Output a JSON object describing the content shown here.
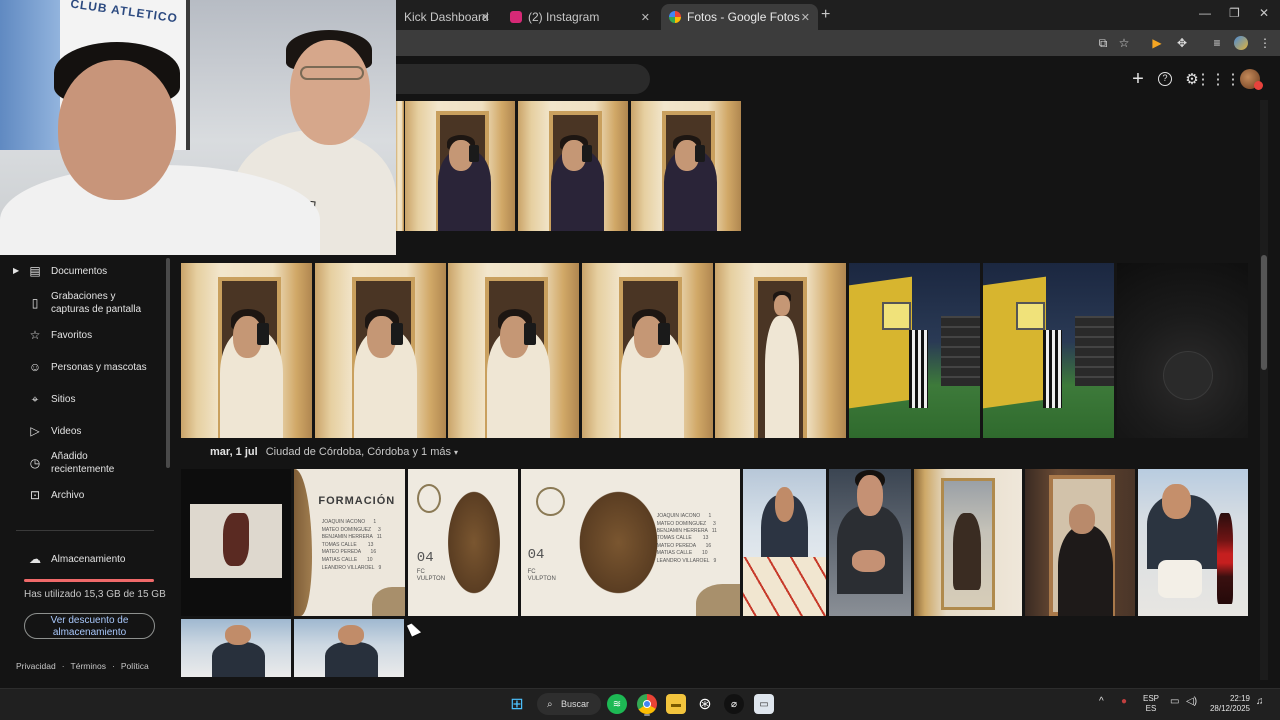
{
  "browser": {
    "tabs": [
      {
        "title": "Kick Dashboard",
        "favicon_color": "#53fc18"
      },
      {
        "title": "(2) Instagram",
        "favicon_color": "#d62976"
      },
      {
        "title": "Fotos - Google Fotos",
        "favicon_color": "#4285f4",
        "active": true
      }
    ],
    "new_tab_icon": "plus-icon",
    "window_controls": [
      "minimize-icon",
      "restore-icon",
      "close-icon"
    ]
  },
  "app_header": {
    "actions": [
      "add-icon",
      "help-icon",
      "settings-icon",
      "apps-grid-icon",
      "account-avatar"
    ]
  },
  "sidebar": {
    "items": [
      {
        "label": "Documentos",
        "icon": "document-icon"
      },
      {
        "label": "Grabaciones y capturas de pantalla",
        "line1": "Grabaciones y",
        "line2": "capturas de pantalla",
        "icon": "phone-screen-icon"
      },
      {
        "label": "Favoritos",
        "icon": "star-icon"
      },
      {
        "label": "Personas y mascotas",
        "icon": "face-icon"
      },
      {
        "label": "Sitios",
        "icon": "location-pin-icon"
      },
      {
        "label": "Videos",
        "icon": "play-icon"
      },
      {
        "label": "Añadido recientemente",
        "line1": "Añadido",
        "line2": "recientemente",
        "icon": "clock-icon"
      },
      {
        "label": "Archivo",
        "icon": "archive-icon"
      }
    ],
    "storage": {
      "label": "Almacenamiento",
      "usage_text": "Has utilizado 15,3 GB de 15 GB",
      "usage_fraction": 1.0,
      "bar_color": "#f06a6a",
      "button_line1": "Ver descuento de",
      "button_line2": "almacenamiento"
    },
    "footer": {
      "privacy": "Privacidad",
      "terms": "Términos",
      "policy": "Política",
      "separator": "·"
    }
  },
  "photo_groups": {
    "date_header": {
      "date": "mar, 1 jul",
      "location": "Ciudad de Córdoba, Córdoba y 1 más"
    },
    "poster": {
      "title": "FORMACIÓN",
      "roster": "JOAQUIN IACONO      1\nMATEO DOMINGUEZ     3\nBENJAMIN HERRERA   11\nTOMAS CALLE        13\nMATEO PEREDA       16\nMATIAS CALLE       10\nLEANDRO VILLAROEL   9",
      "number": "04",
      "team_line1": "FC",
      "team_line2": "VULPTON"
    }
  },
  "webcam": {
    "club_text": "CLUB ATLETICO",
    "shirt_text": "VANS"
  },
  "taskbar": {
    "search_label": "Buscar",
    "language_line1": "ESP",
    "language_line2": "ES",
    "time": "22:19",
    "date": "28/12/2025"
  }
}
